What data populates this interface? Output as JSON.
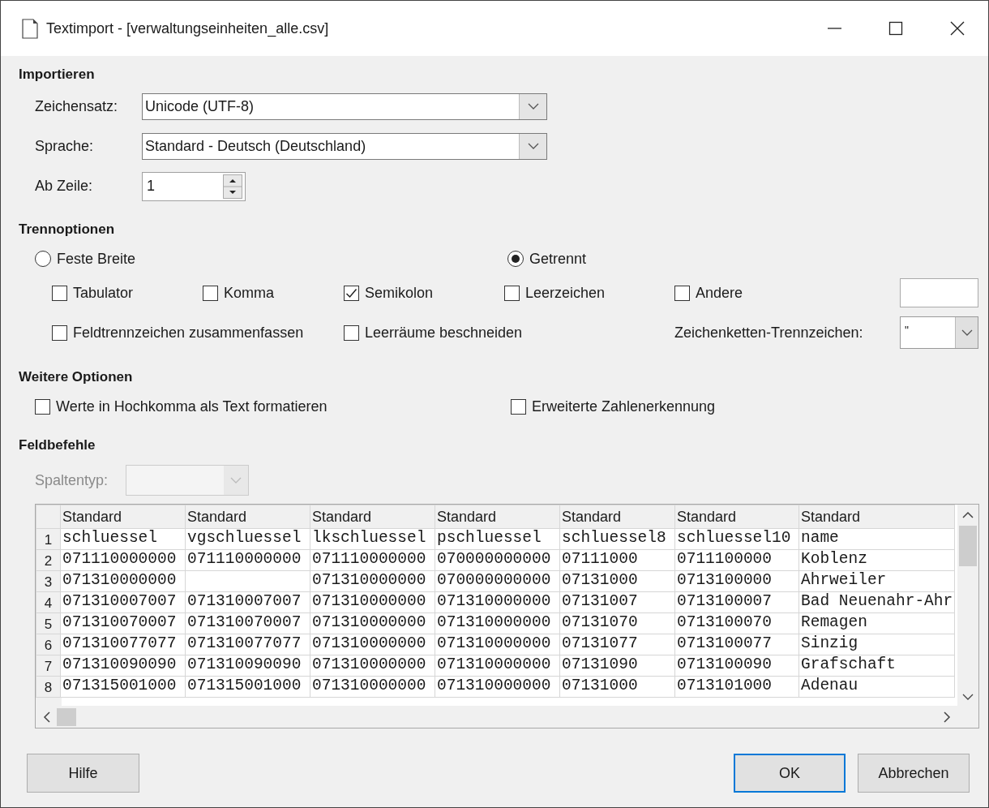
{
  "window": {
    "title": "Textimport - [verwaltungseinheiten_alle.csv]"
  },
  "import": {
    "heading": "Importieren",
    "fields": [
      {
        "kind": "combo",
        "label": "Zeichensatz:",
        "value": "Unicode (UTF-8)"
      },
      {
        "kind": "combo",
        "label": "Sprache:",
        "value": "Standard - Deutsch (Deutschland)"
      },
      {
        "kind": "spin",
        "label": "Ab Zeile:",
        "value": "1"
      }
    ]
  },
  "separator_options": {
    "heading": "Trennoptionen",
    "modes": [
      {
        "label": "Feste Breite",
        "selected": false
      },
      {
        "label": "Getrennt",
        "selected": true
      }
    ],
    "separators": [
      {
        "label": "Tabulator",
        "checked": false
      },
      {
        "label": "Komma",
        "checked": false
      },
      {
        "label": "Semikolon",
        "checked": true
      },
      {
        "label": "Leerzeichen",
        "checked": false
      },
      {
        "label": "Andere",
        "checked": false
      }
    ],
    "merge_options": [
      {
        "label": "Feldtrennzeichen zusammenfassen",
        "checked": false
      },
      {
        "label": "Leerräume beschneiden",
        "checked": false
      }
    ],
    "string_delimiter": {
      "label": "Zeichenketten-Trennzeichen:",
      "value": "\""
    }
  },
  "other_options": {
    "heading": "Weitere Optionen",
    "options": [
      {
        "label": "Werte in Hochkomma als Text formatieren",
        "checked": false
      },
      {
        "label": "Erweiterte Zahlenerkennung",
        "checked": false
      }
    ]
  },
  "field_commands": {
    "heading": "Feldbefehle",
    "column_type": {
      "label": "Spaltentyp:",
      "disabled": true
    }
  },
  "preview": {
    "columns": [
      "Standard",
      "Standard",
      "Standard",
      "Standard",
      "Standard",
      "Standard",
      "Standard"
    ],
    "rows": [
      {
        "number": "1",
        "cells": [
          "schluessel",
          "vgschluessel",
          "lkschluessel",
          "pschluessel",
          "schluessel8",
          "schluessel10",
          "name"
        ]
      },
      {
        "number": "2",
        "cells": [
          "071110000000",
          "071110000000",
          "071110000000",
          "070000000000",
          "07111000",
          "0711100000",
          "Koblenz"
        ]
      },
      {
        "number": "3",
        "cells": [
          "071310000000",
          "",
          "071310000000",
          "070000000000",
          "07131000",
          "0713100000",
          "Ahrweiler"
        ]
      },
      {
        "number": "4",
        "cells": [
          "071310007007",
          "071310007007",
          "071310000000",
          "071310000000",
          "07131007",
          "0713100007",
          "Bad Neuenahr-Ahr"
        ]
      },
      {
        "number": "5",
        "cells": [
          "071310070007",
          "071310070007",
          "071310000000",
          "071310000000",
          "07131070",
          "0713100070",
          "Remagen"
        ]
      },
      {
        "number": "6",
        "cells": [
          "071310077077",
          "071310077077",
          "071310000000",
          "071310000000",
          "07131077",
          "0713100077",
          "Sinzig"
        ]
      },
      {
        "number": "7",
        "cells": [
          "071310090090",
          "071310090090",
          "071310000000",
          "071310000000",
          "07131090",
          "0713100090",
          "Grafschaft"
        ]
      },
      {
        "number": "8",
        "cells": [
          "071315001000",
          "071315001000",
          "071310000000",
          "071310000000",
          "07131000",
          "0713101000",
          "Adenau"
        ]
      }
    ]
  },
  "buttons": [
    {
      "label": "Hilfe",
      "default": false
    },
    {
      "label": "OK",
      "default": true
    },
    {
      "label": "Abbrechen",
      "default": false
    }
  ]
}
